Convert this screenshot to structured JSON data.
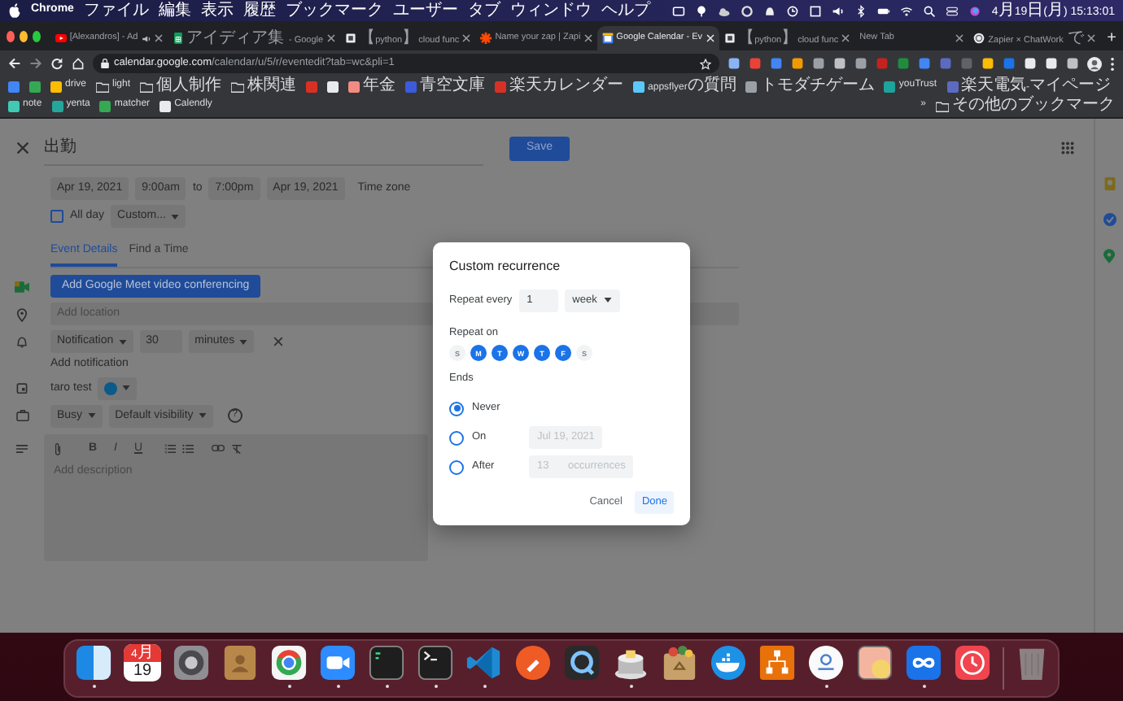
{
  "menu_bar": {
    "app": "Chrome",
    "menus": [
      "ファイル",
      "編集",
      "表示",
      "履歴",
      "ブックマーク",
      "ユーザー",
      "タブ",
      "ウィンドウ",
      "ヘルプ"
    ],
    "clock": "4月19日(月)  15:13:01"
  },
  "tabs": [
    {
      "kind": "youtube",
      "title": "[Alexandros] - Ad",
      "audio": true,
      "selected": false
    },
    {
      "kind": "sheets",
      "title": "アイディア集 - Google",
      "audio": false,
      "selected": false
    },
    {
      "kind": "page",
      "title": "【python】cloud func",
      "audio": false,
      "selected": false
    },
    {
      "kind": "zapier",
      "title": "Name your zap | Zapi",
      "audio": false,
      "selected": false
    },
    {
      "kind": "calendar",
      "title": "Google Calendar - Ev",
      "audio": false,
      "selected": true
    },
    {
      "kind": "page",
      "title": "【python】cloud func",
      "audio": false,
      "selected": false
    },
    {
      "kind": "blank",
      "title": "New Tab",
      "audio": false,
      "selected": false
    },
    {
      "kind": "globe",
      "title": "Zapier × ChatWork で",
      "audio": false,
      "selected": false
    }
  ],
  "new_tab": "+",
  "address_bar": {
    "url": "calendar.google.com/calendar/u/5/r/eventedit?tab=wc&pli=1"
  },
  "bookmarks": [
    {
      "kind": "site",
      "color": "#4285f4"
    },
    {
      "kind": "site",
      "color": "#34a853"
    },
    {
      "kind": "site",
      "label": "drive",
      "color": "#fbbc04"
    },
    {
      "kind": "folder",
      "label": "light"
    },
    {
      "kind": "folder",
      "label": "個人制作"
    },
    {
      "kind": "folder",
      "label": "株関連"
    },
    {
      "kind": "site",
      "color": "#d93025"
    },
    {
      "kind": "site",
      "color": "#e8eaed"
    },
    {
      "kind": "site",
      "label": "年金",
      "color": "#f28b82"
    },
    {
      "kind": "site",
      "label": "青空文庫",
      "color": "#3b5bdb"
    },
    {
      "kind": "site",
      "label": "楽天カレンダー",
      "color": "#d93025"
    },
    {
      "kind": "site",
      "label": "appsflyerの質問",
      "color": "#5ac8fa"
    },
    {
      "kind": "site",
      "label": "トモダチゲーム",
      "color": "#9aa0a6"
    },
    {
      "kind": "site",
      "label": "youTrust",
      "color": "#1ba39c"
    },
    {
      "kind": "site",
      "label": "楽天電気-マイページ",
      "color": "#5c6bc0"
    },
    {
      "kind": "site",
      "label": "note",
      "color": "#41c9b4"
    },
    {
      "kind": "site",
      "label": "yenta",
      "color": "#26a69a"
    },
    {
      "kind": "site",
      "label": "matcher",
      "color": "#34a853"
    },
    {
      "kind": "site",
      "label": "Calendly",
      "color": "#e8eaed"
    }
  ],
  "more_bookmarks": "»",
  "other_bookmarks": "その他のブックマーク",
  "event": {
    "title": "出勤",
    "save": "Save",
    "start_date": "Apr 19, 2021",
    "start_time": "9:00am",
    "to": "to",
    "end_time": "7:00pm",
    "end_date": "Apr 19, 2021",
    "time_zone": "Time zone",
    "all_day": {
      "label": "All day",
      "checked": false
    },
    "recurrence": "Custom...",
    "detail_tabs": [
      {
        "label": "Event Details",
        "selected": true
      },
      {
        "label": "Find a Time",
        "selected": false
      }
    ],
    "meet_button": "Add Google Meet video conferencing",
    "location": {
      "placeholder": "Add location"
    },
    "notification": {
      "type": "Notification",
      "value": "30",
      "unit": "minutes"
    },
    "add_notification": "Add notification",
    "calendar": {
      "name": "taro test",
      "color": "#0b5a8a"
    },
    "availability": "Busy",
    "visibility": "Default visibility",
    "help": "?",
    "description": {
      "format_buttons": [
        "B",
        "I",
        "U"
      ],
      "placeholder": "Add description"
    }
  },
  "dialog": {
    "title": "Custom recurrence",
    "repeat_every": {
      "label": "Repeat every",
      "value": "1",
      "unit": "week"
    },
    "repeat_on": {
      "label": "Repeat on",
      "days": [
        {
          "letter": "S",
          "selected": false
        },
        {
          "letter": "M",
          "selected": true
        },
        {
          "letter": "T",
          "selected": true
        },
        {
          "letter": "W",
          "selected": true
        },
        {
          "letter": "T",
          "selected": true
        },
        {
          "letter": "F",
          "selected": true
        },
        {
          "letter": "S",
          "selected": false
        }
      ]
    },
    "ends": {
      "label": "Ends",
      "options": [
        {
          "kind": "never",
          "label": "Never",
          "selected": true
        },
        {
          "kind": "on",
          "label": "On",
          "selected": false,
          "value": "Jul 19, 2021"
        },
        {
          "kind": "after",
          "label": "After",
          "selected": false,
          "value": "13",
          "suffix": "occurrences"
        }
      ]
    },
    "cancel": "Cancel",
    "done": "Done"
  },
  "dock": {
    "items": [
      {
        "kind": "finder",
        "running": true
      },
      {
        "kind": "calendar",
        "month": "4月",
        "day": "19",
        "running": false
      },
      {
        "kind": "settings",
        "running": false
      },
      {
        "kind": "contacts",
        "running": false
      },
      {
        "kind": "chrome",
        "running": true
      },
      {
        "kind": "zoom",
        "running": true
      },
      {
        "kind": "terminal_green",
        "running": true
      },
      {
        "kind": "terminal",
        "running": true
      },
      {
        "kind": "vscode",
        "running": true
      },
      {
        "kind": "postman",
        "running": false
      },
      {
        "kind": "quicktime",
        "running": false
      },
      {
        "kind": "sequel",
        "running": true
      },
      {
        "kind": "recycle",
        "running": false
      },
      {
        "kind": "docker",
        "running": false
      },
      {
        "kind": "flow",
        "running": false
      },
      {
        "kind": "circle",
        "running": true
      },
      {
        "kind": "preview",
        "running": false
      },
      {
        "kind": "infinity",
        "running": true
      },
      {
        "kind": "clock",
        "running": false
      }
    ]
  }
}
